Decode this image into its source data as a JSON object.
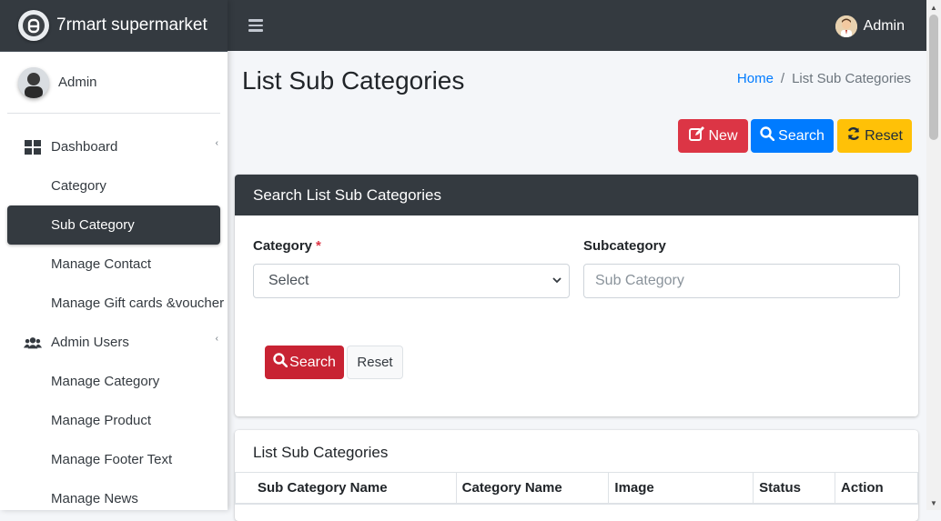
{
  "brand": {
    "name": "7rmart supermarket"
  },
  "user": {
    "name": "Admin"
  },
  "topbar": {
    "user_name": "Admin"
  },
  "sidebar": {
    "items": [
      {
        "label": "Dashboard"
      },
      {
        "label": "Category"
      },
      {
        "label": "Sub Category"
      },
      {
        "label": "Manage Contact"
      },
      {
        "label": "Manage Gift cards &voucher"
      },
      {
        "label": "Admin Users"
      },
      {
        "label": "Manage Category"
      },
      {
        "label": "Manage Product"
      },
      {
        "label": "Manage Footer Text"
      },
      {
        "label": "Manage News"
      }
    ]
  },
  "page": {
    "title": "List Sub Categories",
    "breadcrumb": {
      "home": "Home",
      "separator": "/",
      "current": "List Sub Categories"
    }
  },
  "toolbar": {
    "new_label": "New",
    "search_label": "Search",
    "reset_label": "Reset"
  },
  "search_card": {
    "title": "Search List Sub Categories",
    "category_label": "Category",
    "required_mark": "*",
    "category_selected": "Select",
    "subcategory_label": "Subcategory",
    "subcategory_placeholder": "Sub Category",
    "search_button": "Search",
    "reset_button": "Reset"
  },
  "list_card": {
    "title": "List Sub Categories",
    "columns": [
      "Sub Category Name",
      "Category Name",
      "Image",
      "Status",
      "Action"
    ]
  },
  "colors": {
    "dark": "#343a40",
    "danger": "#dc3545",
    "primary": "#007bff",
    "warning": "#ffc107"
  }
}
